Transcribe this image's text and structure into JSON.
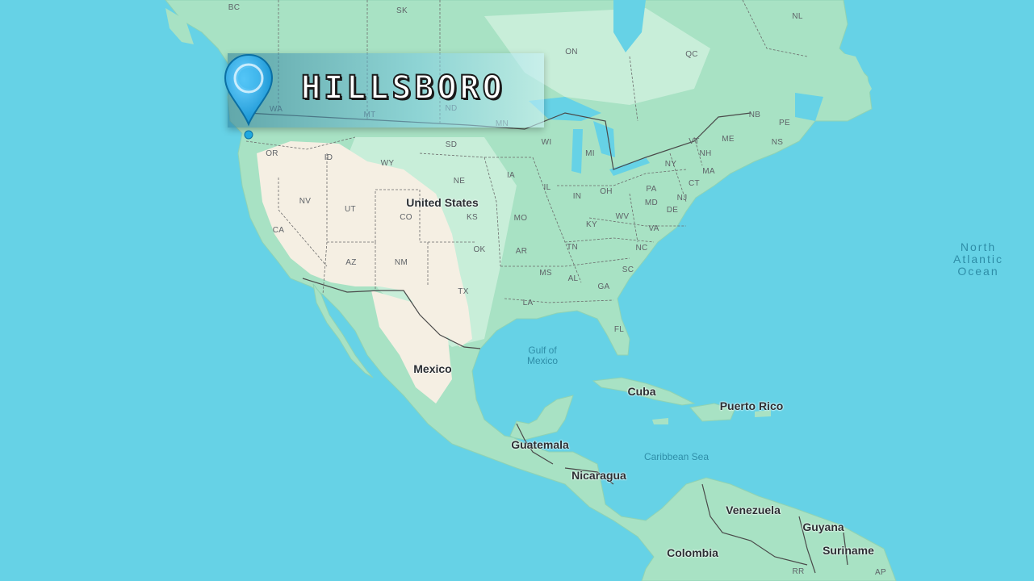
{
  "map": {
    "colors": {
      "ocean": "#66d2e6",
      "forest": "#a8e2c4",
      "lowland": "#c8eed9",
      "desert": "#f5efe3",
      "border": "#555555"
    }
  },
  "marker": {
    "city": "HILLSBORO",
    "pin_color": "#1fa9e0",
    "icon": "map-pin-icon"
  },
  "labels": {
    "states": {
      "BC": "BC",
      "SK": "SK",
      "ON": "ON",
      "QC": "QC",
      "NL": "NL",
      "NB": "NB",
      "PE": "PE",
      "NS": "NS",
      "WA": "WA",
      "MT": "MT",
      "ND": "ND",
      "MN": "MN",
      "OR": "OR",
      "ID": "ID",
      "WY": "WY",
      "SD": "SD",
      "WI": "WI",
      "MI": "MI",
      "NE": "NE",
      "IA": "IA",
      "IL": "IL",
      "IN": "IN",
      "OH": "OH",
      "PA": "PA",
      "NY": "NY",
      "VT": "VT",
      "NH": "NH",
      "ME": "ME",
      "MA": "MA",
      "CT": "CT",
      "NJ": "NJ",
      "MD": "MD",
      "DE": "DE",
      "NV": "NV",
      "UT": "UT",
      "CO": "CO",
      "KS": "KS",
      "MO": "MO",
      "KY": "KY",
      "WV": "WV",
      "VA": "VA",
      "CA": "CA",
      "AZ": "AZ",
      "NM": "NM",
      "OK": "OK",
      "AR": "AR",
      "TN": "TN",
      "NC": "NC",
      "SC": "SC",
      "MS": "MS",
      "AL": "AL",
      "GA": "GA",
      "TX": "TX",
      "LA": "LA",
      "FL": "FL",
      "RR": "RR",
      "AP": "AP"
    },
    "countries": {
      "usa": "United States",
      "mexico": "Mexico",
      "cuba": "Cuba",
      "puerto_rico": "Puerto Rico",
      "guatemala": "Guatemala",
      "nicaragua": "Nicaragua",
      "venezuela": "Venezuela",
      "guyana": "Guyana",
      "suriname": "Suriname",
      "colombia": "Colombia"
    },
    "water": {
      "gulf_1": "Gulf of",
      "gulf_2": "Mexico",
      "caribbean": "Caribbean Sea",
      "atlantic_1": "North",
      "atlantic_2": "Atlantic",
      "atlantic_3": "Ocean"
    }
  }
}
